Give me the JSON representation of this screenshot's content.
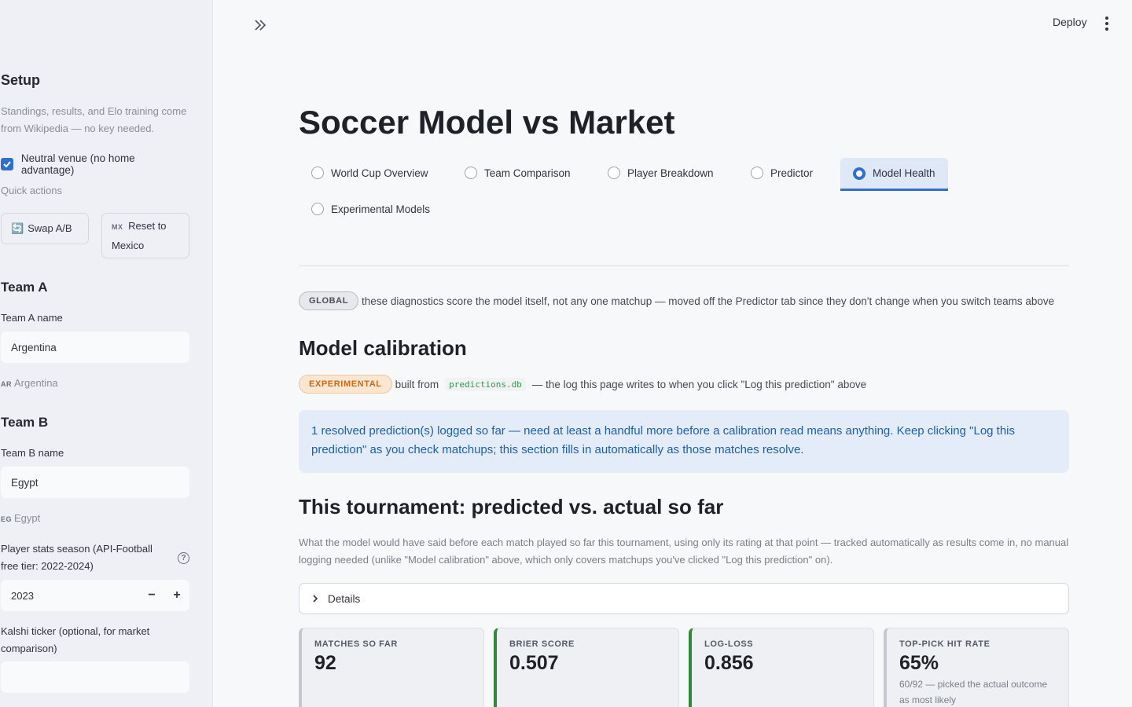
{
  "sidebar": {
    "setup_heading": "Setup",
    "setup_caption": "Standings, results, and Elo training come from Wikipedia — no key needed.",
    "neutral_label": "Neutral venue (no home advantage)",
    "neutral_checked": true,
    "quick_actions_label": "Quick actions",
    "swap_icon": "🔄",
    "swap_label": "Swap A/B",
    "reset_flag": "MX",
    "reset_label": "Reset to Mexico",
    "team_a_heading": "Team A",
    "team_a_name_label": "Team A name",
    "team_a_value": "Argentina",
    "team_a_flag": "AR",
    "team_a_resolved": "Argentina",
    "team_b_heading": "Team B",
    "team_b_name_label": "Team B name",
    "team_b_value": "Egypt",
    "team_b_flag": "EG",
    "team_b_resolved": "Egypt",
    "season_label": "Player stats season (API-Football free tier: 2022-2024)",
    "season_value": "2023",
    "minus_label": "−",
    "plus_label": "+",
    "kalshi_label": "Kalshi ticker (optional, for market comparison)",
    "kalshi_value": ""
  },
  "header": {
    "deploy_label": "Deploy"
  },
  "main": {
    "title": "Soccer Model vs Market",
    "tabs": [
      {
        "label": "World Cup Overview",
        "selected": false
      },
      {
        "label": "Team Comparison",
        "selected": false
      },
      {
        "label": "Player Breakdown",
        "selected": false
      },
      {
        "label": "Predictor",
        "selected": false
      },
      {
        "label": "Model Health",
        "selected": true
      },
      {
        "label": "Experimental Models",
        "selected": false
      }
    ],
    "global_pill": "GLOBAL",
    "global_text": "these diagnostics score the model itself, not any one matchup — moved off the Predictor tab since they don't change when you switch teams above",
    "calibration_heading": "Model calibration",
    "experimental_pill": "EXPERIMENTAL",
    "built_from": "built from",
    "db_name": "predictions.db",
    "built_from_rest": "— the log this page writes to when you click \"Log this prediction\" above",
    "info_text": "1 resolved prediction(s) logged so far — need at least a handful more before a calibration read means anything. Keep clicking \"Log this prediction\" as you check matchups; this section fills in automatically as those matches resolve.",
    "tournament_heading": "This tournament: predicted vs. actual so far",
    "tournament_caption": "What the model would have said before each match played so far this tournament, using only its rating at that point — tracked automatically as results come in, no manual logging needed (unlike \"Model calibration\" above, which only covers matchups you've clicked \"Log this prediction\" on).",
    "details_label": "Details",
    "metrics": [
      {
        "label": "MATCHES SO FAR",
        "value": "92",
        "note": ""
      },
      {
        "label": "BRIER SCORE",
        "value": "0.507",
        "note": ""
      },
      {
        "label": "LOG-LOSS",
        "value": "0.856",
        "note": ""
      },
      {
        "label": "TOP-PICK HIT RATE",
        "value": "65%",
        "note": "60/92 — picked the actual outcome as most likely"
      }
    ]
  },
  "colors": {
    "accent": "#2f6fcf",
    "metric_green": "#2d8a3b",
    "info_bg": "#e3ecf8",
    "info_text": "#1d5fa8",
    "experimental": "#c96a16"
  }
}
